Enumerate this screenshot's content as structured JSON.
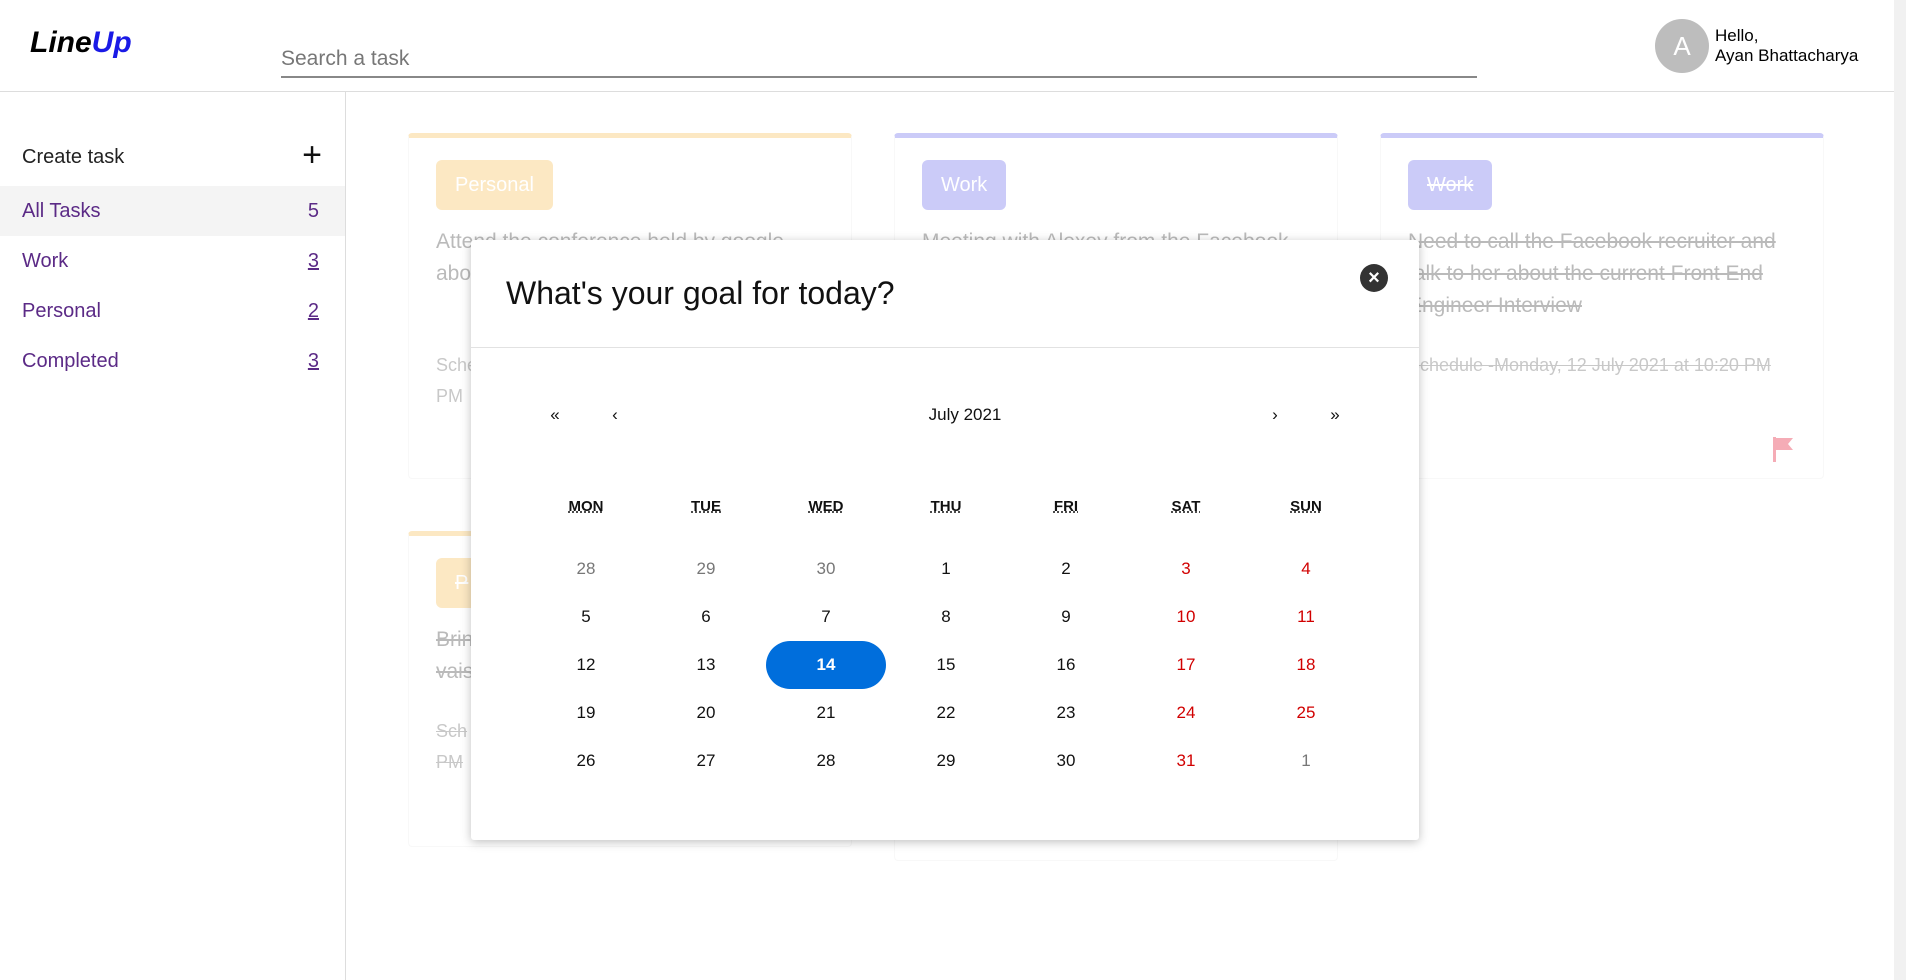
{
  "header": {
    "logo_part1": "Line",
    "logo_part2": "Up",
    "search_placeholder": "Search a task",
    "avatar_initial": "A",
    "greeting": "Hello,",
    "user_name": "Ayan Bhattacharya"
  },
  "sidebar": {
    "create_label": "Create task",
    "create_icon": "+",
    "items": [
      {
        "label": "All Tasks",
        "count": "5"
      },
      {
        "label": "Work",
        "count": "3"
      },
      {
        "label": "Personal",
        "count": "2"
      },
      {
        "label": "Completed",
        "count": "3"
      }
    ]
  },
  "cards": [
    {
      "tag": "Personal",
      "tag_color": "#f9c76a",
      "desc": "Attend the conference held by google about",
      "sched": "Sche",
      "sched2": "PM"
    },
    {
      "tag": "Work",
      "tag_color": "#8080f0",
      "desc": "Meeting with Alexey from the Facebook"
    },
    {
      "tag": "Work",
      "tag_color": "#8080f0",
      "desc": "Need to call the Facebook recruiter and talk to her about the current Front End Engineer Interview",
      "sched": "Schedule -Monday, 12 July 2021 at 10:20 PM"
    },
    {
      "tag": "P",
      "tag_color": "#f9c76a",
      "desc": "Brin",
      "desc2": "vais",
      "sched": "Sch",
      "sched2": "PM"
    }
  ],
  "modal": {
    "title": "What's your goal for today?",
    "close_icon": "×",
    "calendar": {
      "month_label": "July 2021",
      "prev2": "«",
      "prev": "‹",
      "next": "›",
      "next2": "»",
      "weekdays": [
        "MON",
        "TUE",
        "WED",
        "THU",
        "FRI",
        "SAT",
        "SUN"
      ],
      "weeks": [
        [
          "28",
          "29",
          "30",
          "1",
          "2",
          "3",
          "4"
        ],
        [
          "5",
          "6",
          "7",
          "8",
          "9",
          "10",
          "11"
        ],
        [
          "12",
          "13",
          "14",
          "15",
          "16",
          "17",
          "18"
        ],
        [
          "19",
          "20",
          "21",
          "22",
          "23",
          "24",
          "25"
        ],
        [
          "26",
          "27",
          "28",
          "29",
          "30",
          "31",
          "1"
        ]
      ],
      "selected": "14"
    }
  },
  "colors": {
    "accent": "#006edc",
    "weekend": "#d10000",
    "nav_text": "#5b2a86"
  }
}
